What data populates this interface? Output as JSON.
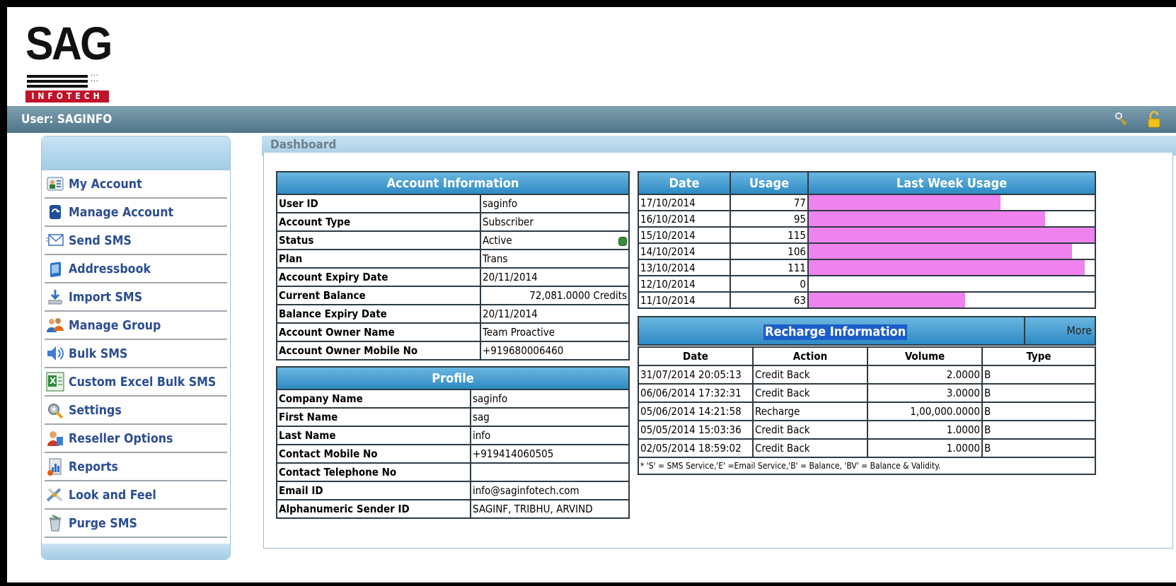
{
  "brand": {
    "name": "SAG",
    "sub": "INFOTECH",
    "accent": "#c0132a"
  },
  "userbar": {
    "label": "User: SAGINFO",
    "icons": [
      "key-icon",
      "lock-icon"
    ]
  },
  "sidebar": {
    "items": [
      {
        "label": "My Account",
        "icon": "my-account-icon"
      },
      {
        "label": "Manage Account",
        "icon": "manage-account-icon"
      },
      {
        "label": "Send SMS",
        "icon": "envelope-icon"
      },
      {
        "label": "Addressbook",
        "icon": "addressbook-icon"
      },
      {
        "label": "Import SMS",
        "icon": "import-icon"
      },
      {
        "label": "Manage Group",
        "icon": "group-icon"
      },
      {
        "label": "Bulk SMS",
        "icon": "bulk-sms-icon"
      },
      {
        "label": "Custom Excel Bulk SMS",
        "icon": "excel-icon"
      },
      {
        "label": "Settings",
        "icon": "settings-icon"
      },
      {
        "label": "Reseller Options",
        "icon": "reseller-icon"
      },
      {
        "label": "Reports",
        "icon": "reports-icon"
      },
      {
        "label": "Look and Feel",
        "icon": "look-and-feel-icon"
      },
      {
        "label": "Purge SMS",
        "icon": "purge-icon"
      }
    ]
  },
  "dashboard": {
    "title": "Dashboard"
  },
  "account": {
    "title": "Account Information",
    "rows": [
      {
        "label": "User ID",
        "value": "saginfo"
      },
      {
        "label": "Account Type",
        "value": "Subscriber"
      },
      {
        "label": "Status",
        "value": "Active"
      },
      {
        "label": "Plan",
        "value": "Trans"
      },
      {
        "label": "Account Expiry Date",
        "value": "20/11/2014"
      },
      {
        "label": "Current Balance",
        "value": "72,081.0000 Credits"
      },
      {
        "label": "Balance Expiry Date",
        "value": "20/11/2014"
      },
      {
        "label": "Account Owner Name",
        "value": "Team Proactive"
      },
      {
        "label": "Account Owner Mobile No",
        "value": "+919680006460"
      }
    ]
  },
  "profile": {
    "title": "Profile",
    "rows": [
      {
        "label": "Company Name",
        "value": "saginfo"
      },
      {
        "label": "First Name",
        "value": "sag"
      },
      {
        "label": "Last Name",
        "value": "info"
      },
      {
        "label": "Contact Mobile No",
        "value": "+919414060505"
      },
      {
        "label": "Contact Telephone No",
        "value": ""
      },
      {
        "label": "Email ID",
        "value": "info@saginfotech.com"
      },
      {
        "label": "Alphanumeric Sender ID",
        "value": "SAGINF, TRIBHU, ARVIND"
      }
    ]
  },
  "usage": {
    "headers": {
      "date": "Date",
      "usage": "Usage",
      "chart": "Last Week Usage"
    },
    "max": 115,
    "bar_color": "#ee82ee",
    "rows": [
      {
        "date": "17/10/2014",
        "usage": 77
      },
      {
        "date": "16/10/2014",
        "usage": 95
      },
      {
        "date": "15/10/2014",
        "usage": 115
      },
      {
        "date": "14/10/2014",
        "usage": 106
      },
      {
        "date": "13/10/2014",
        "usage": 111
      },
      {
        "date": "12/10/2014",
        "usage": 0
      },
      {
        "date": "11/10/2014",
        "usage": 63
      }
    ]
  },
  "recharge": {
    "title": "Recharge Information",
    "more": "More",
    "headers": {
      "date": "Date",
      "action": "Action",
      "volume": "Volume",
      "type": "Type"
    },
    "rows": [
      {
        "date": "31/07/2014 20:05:13",
        "action": "Credit Back",
        "volume": "2.0000",
        "type": "B"
      },
      {
        "date": "06/06/2014 17:32:31",
        "action": "Credit Back",
        "volume": "3.0000",
        "type": "B"
      },
      {
        "date": "05/06/2014 14:21:58",
        "action": "Recharge",
        "volume": "1,00,000.0000",
        "type": "B"
      },
      {
        "date": "05/05/2014 15:03:36",
        "action": "Credit Back",
        "volume": "1.0000",
        "type": "B"
      },
      {
        "date": "02/05/2014 18:59:02",
        "action": "Credit Back",
        "volume": "1.0000",
        "type": "B"
      }
    ],
    "note": "* 'S' = SMS Service,'E' =Email Service,'B' = Balance, 'BV' = Balance & Validity."
  }
}
